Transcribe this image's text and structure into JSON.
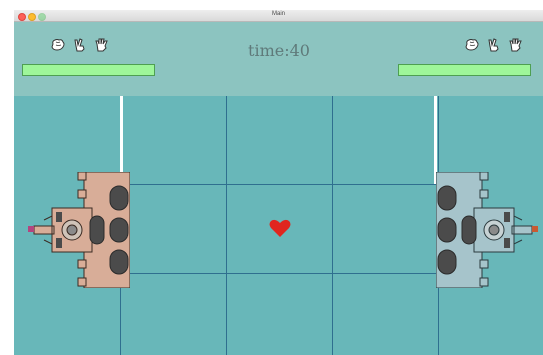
{
  "window": {
    "title": "Main"
  },
  "hud": {
    "timer_text": "time:40",
    "left_player": {
      "hands": [
        "rock-hand-icon",
        "scissors-hand-icon",
        "paper-hand-icon"
      ],
      "health_fraction": 1.0
    },
    "right_player": {
      "hands": [
        "rock-hand-icon",
        "scissors-hand-icon",
        "paper-hand-icon"
      ],
      "health_fraction": 1.0
    }
  },
  "field": {
    "columns": 4,
    "rows": 3,
    "pickup": "heart-icon"
  },
  "colors": {
    "hud_bg": "#8cc4c0",
    "field_bg": "#68b7b9",
    "grid_line": "#2f6f8f",
    "health_fill": "#9ef69a",
    "heart": "#e0261f",
    "left_castle": "#d8ad98",
    "right_castle": "#a6c4cb"
  }
}
